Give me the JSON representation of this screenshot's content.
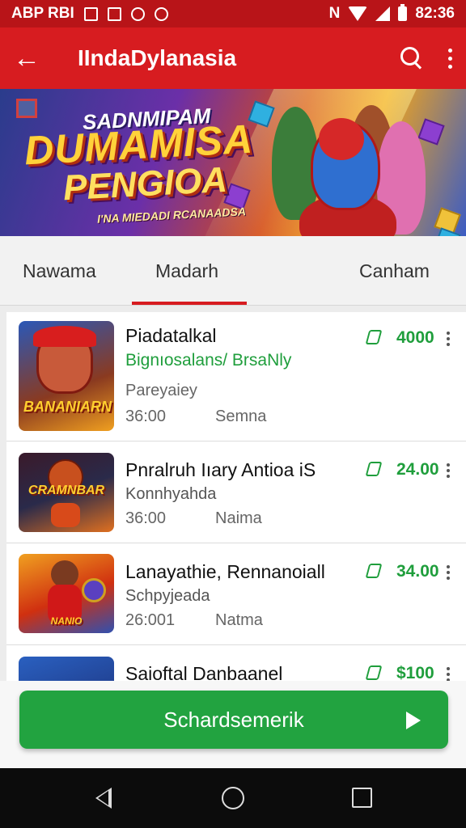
{
  "status_bar": {
    "left_text": "ABP RBI",
    "time": "82:36"
  },
  "app_bar": {
    "title": "IIndaDylanasia"
  },
  "banner": {
    "kicker": "SADNMIPAM",
    "headline_line1": "DUMAMISA",
    "headline_line2": "PENGIOA",
    "tagline": "I'NA MIEDADI RCANAADSA"
  },
  "tabs": [
    {
      "label": "Nawama"
    },
    {
      "label": "Madarh"
    },
    {
      "label": "Canham"
    }
  ],
  "items": [
    {
      "name": "Piadatalkal",
      "subtitle": "Bignıosalans/ BrsaNly",
      "subtitle_style": "green",
      "line3": "Pareyaiey",
      "time": "36:00",
      "meta": "Semna",
      "price": "4000",
      "thumb_label": "BANANIARN"
    },
    {
      "name": "Pnralruh Iıary Antioa iS",
      "subtitle": "Konnhyahda",
      "subtitle_style": "gray",
      "time": "36:00",
      "meta": "Naima",
      "price": "24.00",
      "thumb_label": "CRAMNBAR"
    },
    {
      "name": "Lanayathie, Rennanoiall",
      "subtitle": "Schpyjeada",
      "subtitle_style": "gray",
      "time": "26:001",
      "meta": "Natma",
      "price": "34.00",
      "thumb_label": "NANIO"
    },
    {
      "name": "Saioftal Danbaanel",
      "price": "$100"
    }
  ],
  "cta": {
    "label": "Schardsemerik"
  },
  "colors": {
    "primary_red": "#d71c20",
    "status_red": "#b81418",
    "accent_green": "#22a340",
    "price_green": "#1f9e3c"
  },
  "icons": {
    "back": "arrow-left-icon",
    "search": "search-icon",
    "more": "more-vert-icon",
    "price_tag": "tag-icon",
    "play": "play-icon"
  }
}
